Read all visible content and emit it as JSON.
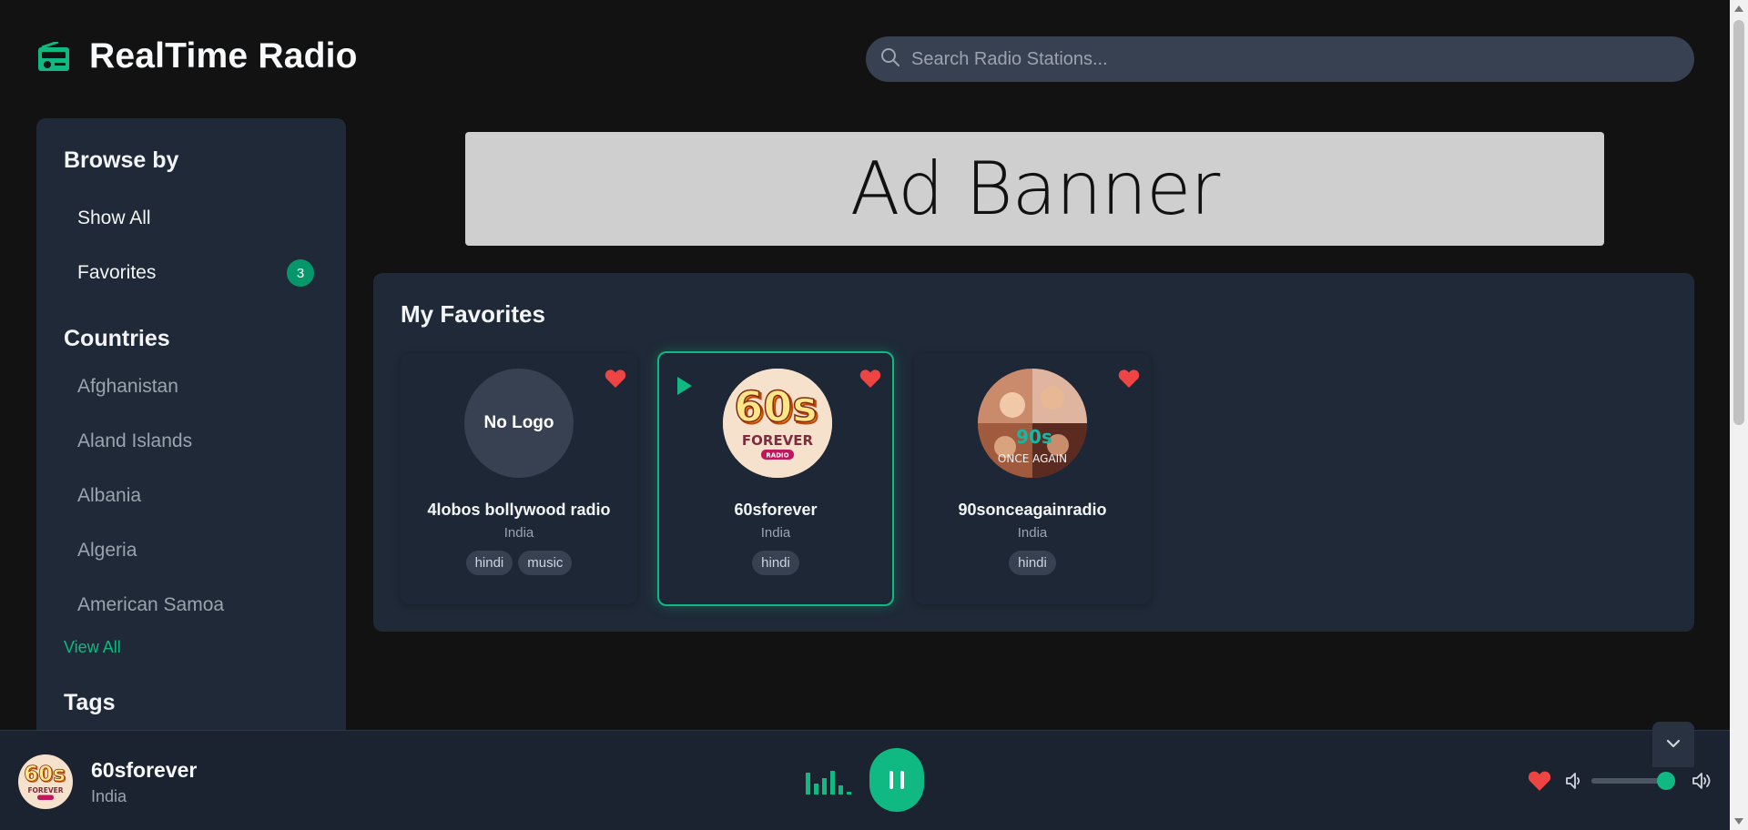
{
  "app": {
    "title": "RealTime Radio",
    "accent": "#10b981",
    "heart_color": "#ef4444"
  },
  "search": {
    "placeholder": "Search Radio Stations..."
  },
  "sidebar": {
    "browse_heading": "Browse by",
    "browse_items": [
      {
        "label": "Show All"
      },
      {
        "label": "Favorites",
        "badge": "3"
      }
    ],
    "countries_heading": "Countries",
    "countries": [
      {
        "label": "Afghanistan"
      },
      {
        "label": "Aland Islands"
      },
      {
        "label": "Albania"
      },
      {
        "label": "Algeria"
      },
      {
        "label": "American Samoa"
      }
    ],
    "view_all": "View All",
    "tags_heading": "Tags"
  },
  "ad": {
    "text": "Ad Banner"
  },
  "favorites": {
    "title": "My Favorites",
    "cards": [
      {
        "name": "4lobos bollywood radio",
        "country": "India",
        "tags": [
          "hindi",
          "music"
        ],
        "logo_text": "No Logo",
        "favorite": true,
        "playing": false
      },
      {
        "name": "60sforever",
        "country": "India",
        "tags": [
          "hindi"
        ],
        "logo_text": "",
        "favorite": true,
        "playing": true
      },
      {
        "name": "90sonceagainradio",
        "country": "India",
        "tags": [
          "hindi"
        ],
        "logo_text": "",
        "favorite": true,
        "playing": false
      }
    ]
  },
  "player": {
    "station": "60sforever",
    "country": "India",
    "favorite": true,
    "volume": 1.0,
    "state": "playing"
  }
}
